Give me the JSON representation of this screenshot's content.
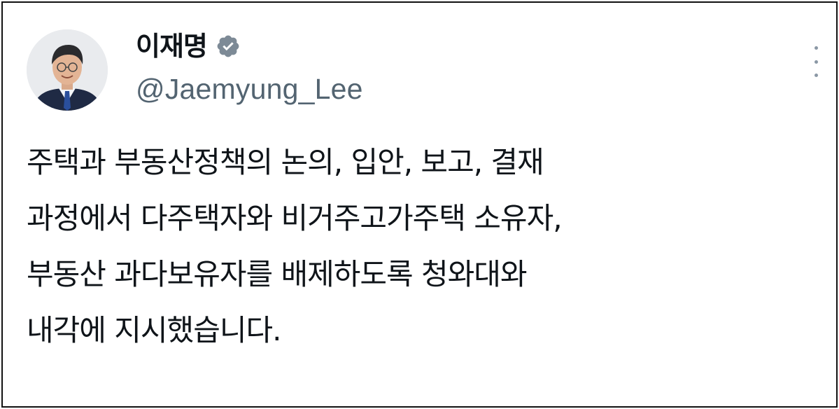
{
  "author": {
    "display_name": "이재명",
    "handle": "@Jaemyung_Lee",
    "avatar_icon": "profile-photo",
    "verified_icon": "verified-badge-icon",
    "verified_color": "#7d8a96"
  },
  "menu": {
    "more_icon": "more-vertical-icon"
  },
  "tweet": {
    "lines": [
      "주택과 부동산정책의 논의, 입안, 보고, 결재",
      "과정에서 다주택자와 비거주고가주택 소유자,",
      "부동산 과다보유자를 배제하도록 청와대와",
      "내각에 지시했습니다."
    ]
  }
}
